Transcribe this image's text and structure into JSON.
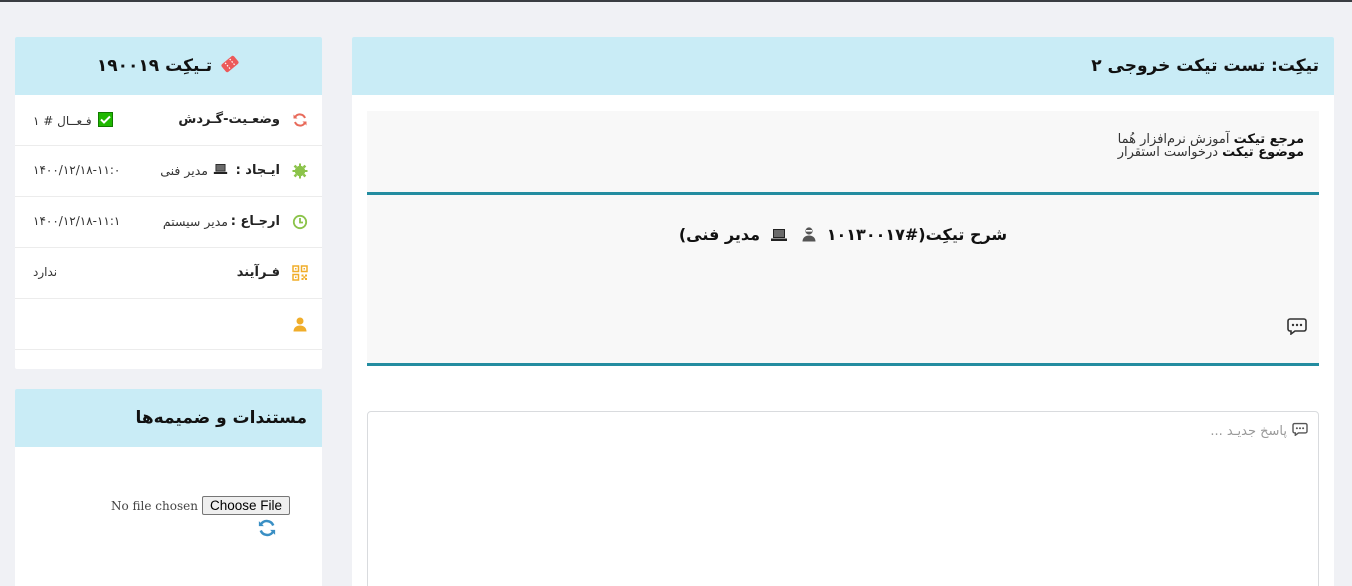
{
  "main": {
    "title": "تیکِت: تست تیکت خروجی ۲",
    "ref_label": "مرجع تیکت",
    "ref_value": "آموزش نرم‌افزار هُما",
    "subject_label": "موضوع تیکت",
    "subject_value": "درخواست استقرار",
    "description_heading_prefix": "شرح تیکِت(#۱۰۱۳۰۰۱۷",
    "description_heading_author": "مدیر فنی)",
    "reply_placeholder": "پاسخ جدیـد ..."
  },
  "ticket_card": {
    "title": "تـیکِت ۱۹۰۰۱۹",
    "rows": [
      {
        "label": "وضعـیت-گـردش",
        "middle": "",
        "value": "فـعــال # ۱",
        "icon": "refresh-icon"
      },
      {
        "label": "ایـجاد :",
        "middle": "مدیر فنی",
        "value": "۱۴۰۰/۱۲/۱۸-۱۱:۰",
        "icon": "gear-icon"
      },
      {
        "label": "ارجـاع :",
        "middle": "مدیر سیستم",
        "value": "۱۴۰۰/۱۲/۱۸-۱۱:۱",
        "icon": "clock-icon"
      },
      {
        "label": "فـرآیند",
        "middle": "",
        "value": "ندارد",
        "icon": "qr-icon"
      },
      {
        "label": "",
        "middle": "",
        "value": "",
        "icon": "user-icon"
      }
    ]
  },
  "docs_card": {
    "title": "مستندات و ضمیمه‌ها",
    "no_file": "No file chosen",
    "choose_button": "Choose File"
  },
  "colors": {
    "header_bg": "#c9ecf6",
    "divider": "#238ca0",
    "active_check": "#1fb800",
    "accent_red": "#e86a5a",
    "accent_green": "#8bc34a",
    "accent_yellow": "#f0ad2a"
  }
}
